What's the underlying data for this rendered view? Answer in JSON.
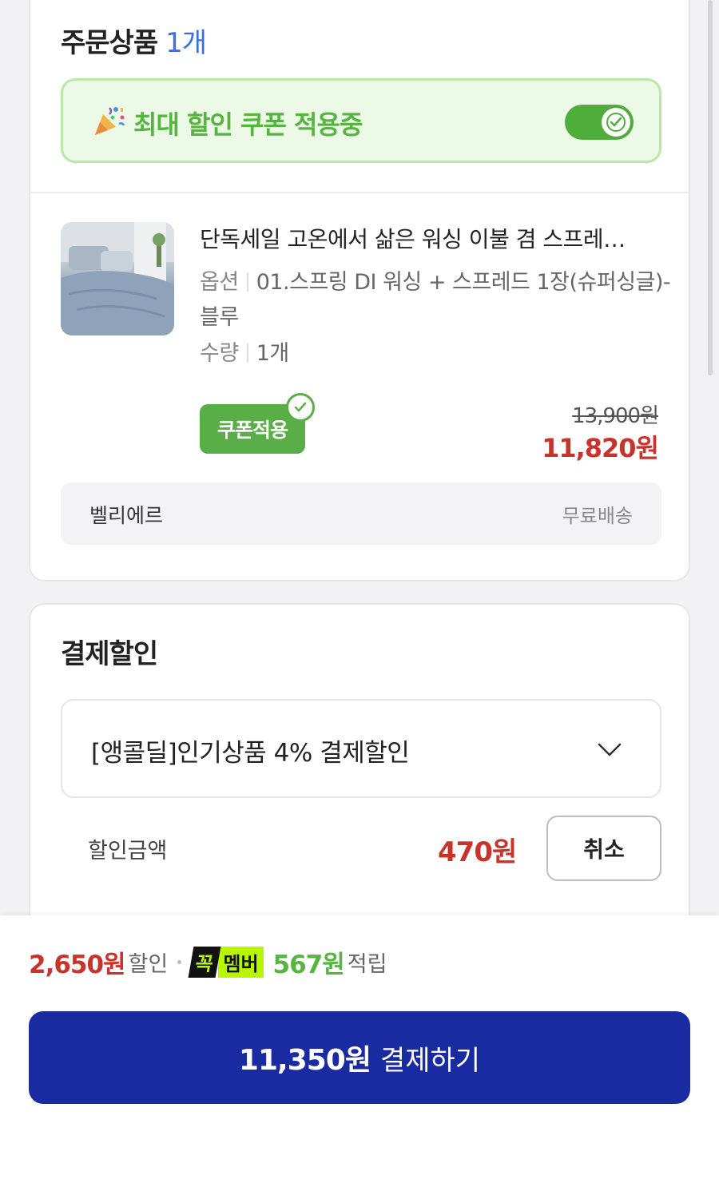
{
  "order": {
    "title": "주문상품",
    "count": "1개"
  },
  "coupon_banner": {
    "icon": "party-popper-icon",
    "text": "최대 할인 쿠폰 적용중",
    "toggle_on": true
  },
  "product": {
    "name": "단독세일 고온에서 삶은 워싱 이불 겸 스프레…",
    "option_label": "옵션",
    "option_value": "01.스프링 DI 워싱 + 스프레드 1장(슈퍼싱글)-블루",
    "qty_label": "수량",
    "qty_value": "1개",
    "coupon_badge": "쿠폰적용",
    "original_price": "13,900원",
    "sale_price": "11,820원"
  },
  "seller": {
    "name": "벨리에르",
    "shipping": "무료배송"
  },
  "payment_discount": {
    "title": "결제할인",
    "selected": "[앵콜딜]인기상품 4% 결제할인",
    "amount_label": "할인금액",
    "amount": "470원",
    "cancel_label": "취소"
  },
  "bottom": {
    "discount_total": "2,650원",
    "discount_label": "할인",
    "member_logo_a": "꼭",
    "member_logo_b": "멤버",
    "points": "567원",
    "points_label": "적립",
    "pay_amount": "11,350원",
    "pay_label": "결제하기"
  },
  "colors": {
    "accent_blue": "#1a2aa0",
    "sale_red": "#c8332b",
    "green": "#56b441"
  }
}
